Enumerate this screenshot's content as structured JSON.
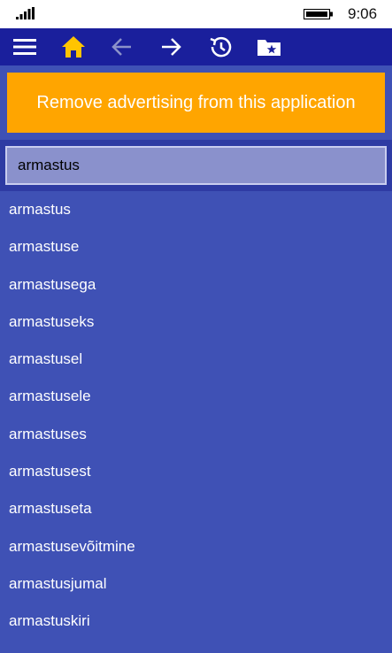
{
  "status_bar": {
    "time": "9:06",
    "icons": [
      "signal-icon",
      "battery-icon"
    ]
  },
  "toolbar": {
    "buttons": [
      {
        "name": "menu",
        "icon": "hamburger-icon"
      },
      {
        "name": "home",
        "icon": "home-icon",
        "color": "#ffc400"
      },
      {
        "name": "back",
        "icon": "arrow-left-icon",
        "disabled": true
      },
      {
        "name": "forward",
        "icon": "arrow-right-icon"
      },
      {
        "name": "history",
        "icon": "history-icon"
      },
      {
        "name": "favorites",
        "icon": "star-folder-icon"
      }
    ]
  },
  "ad_banner": {
    "text": "Remove advertising from this application",
    "color": "#ffa500"
  },
  "search": {
    "value": "armastus"
  },
  "results": [
    "armastus",
    "armastuse",
    "armastusega",
    "armastuseks",
    "armastusel",
    "armastusele",
    "armastuses",
    "armastusest",
    "armastuseta",
    "armastusevõitmine",
    "armastusjumal",
    "armastuskiri"
  ],
  "colors": {
    "background": "#3f51b5",
    "toolbar": "#1a1f9c",
    "accent": "#ffc400"
  }
}
